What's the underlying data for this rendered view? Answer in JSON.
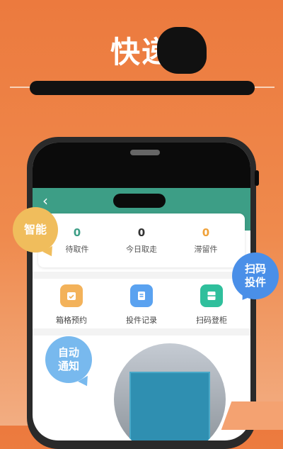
{
  "banner": {
    "title_left": "快",
    "title_mid": "递"
  },
  "app": {
    "back_icon": "chevron-left-icon",
    "stats": [
      {
        "value": "0",
        "label": "待取件",
        "color": "#3d9e86"
      },
      {
        "value": "0",
        "label": "今日取走",
        "color": "#333333"
      },
      {
        "value": "0",
        "label": "滞留件",
        "color": "#f0a23a"
      }
    ],
    "functions": [
      {
        "label": "箱格预约",
        "color": "#f3b25a",
        "icon": "calendar-check-icon"
      },
      {
        "label": "投件记录",
        "color": "#5aa2f0",
        "icon": "document-icon"
      },
      {
        "label": "扫码登柜",
        "color": "#2fbf9c",
        "icon": "cabinet-icon"
      }
    ]
  },
  "bubbles": {
    "smart": "智能",
    "scan": [
      "扫码",
      "投件"
    ],
    "notify": [
      "自动",
      "通知"
    ]
  }
}
